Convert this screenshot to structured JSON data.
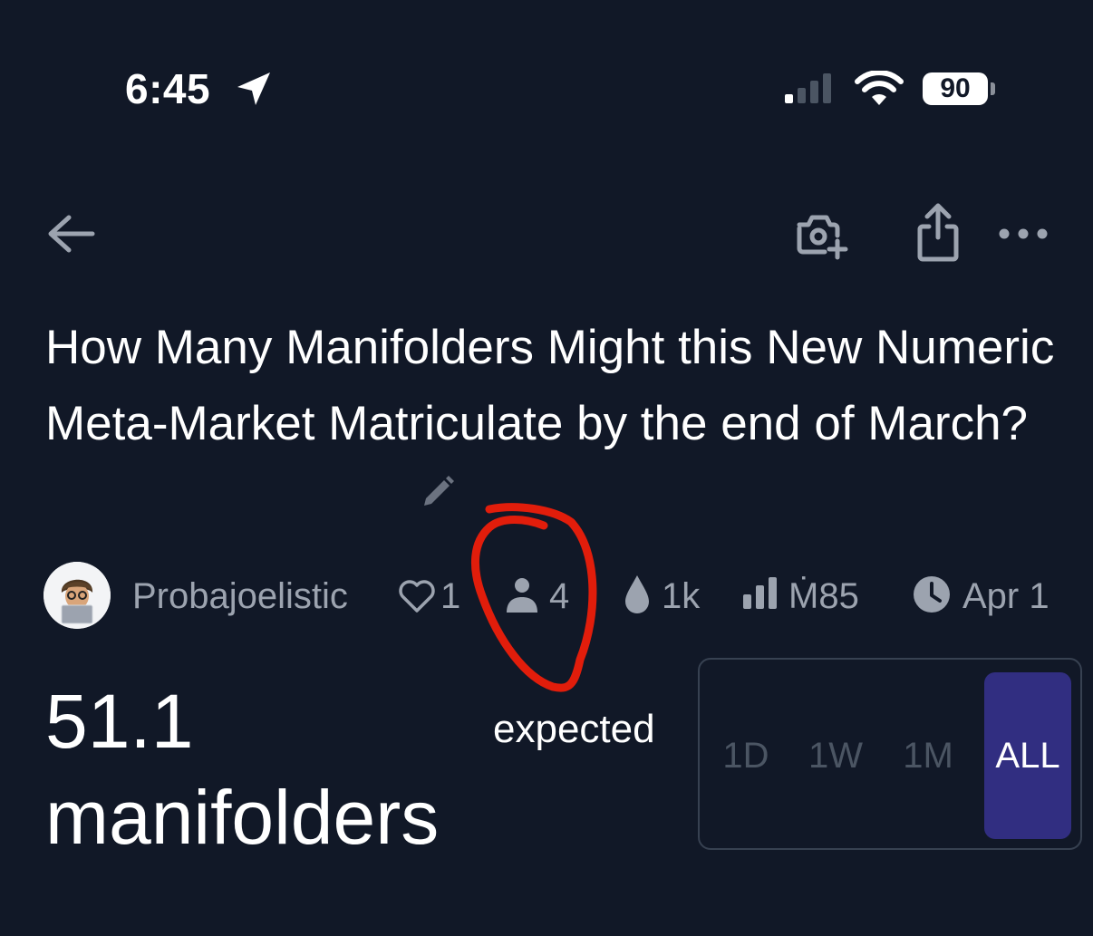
{
  "status_bar": {
    "time": "6:45",
    "battery": "90"
  },
  "market": {
    "title": "How Many Manifolders Might this New Numeric Meta-Market Matriculate by the end of March?",
    "creator": "Probajoelistic",
    "likes": "1",
    "traders": "4",
    "liquidity": "1k",
    "volume": "Ṁ85",
    "close_date": "Apr 1",
    "value": "51.1",
    "unit": "manifolders",
    "value_label": "expected"
  },
  "time_range": {
    "options": [
      "1D",
      "1W",
      "1M",
      "ALL"
    ],
    "selected": "ALL"
  },
  "colors": {
    "background": "#111827",
    "muted_text": "#9ca3af",
    "accent": "#312e81",
    "annotation": "#e11d0b"
  },
  "icons": [
    "back-arrow-icon",
    "camera-plus-icon",
    "share-icon",
    "more-icon",
    "pencil-icon",
    "heart-icon",
    "person-icon",
    "droplet-icon",
    "bar-chart-icon",
    "clock-icon"
  ]
}
